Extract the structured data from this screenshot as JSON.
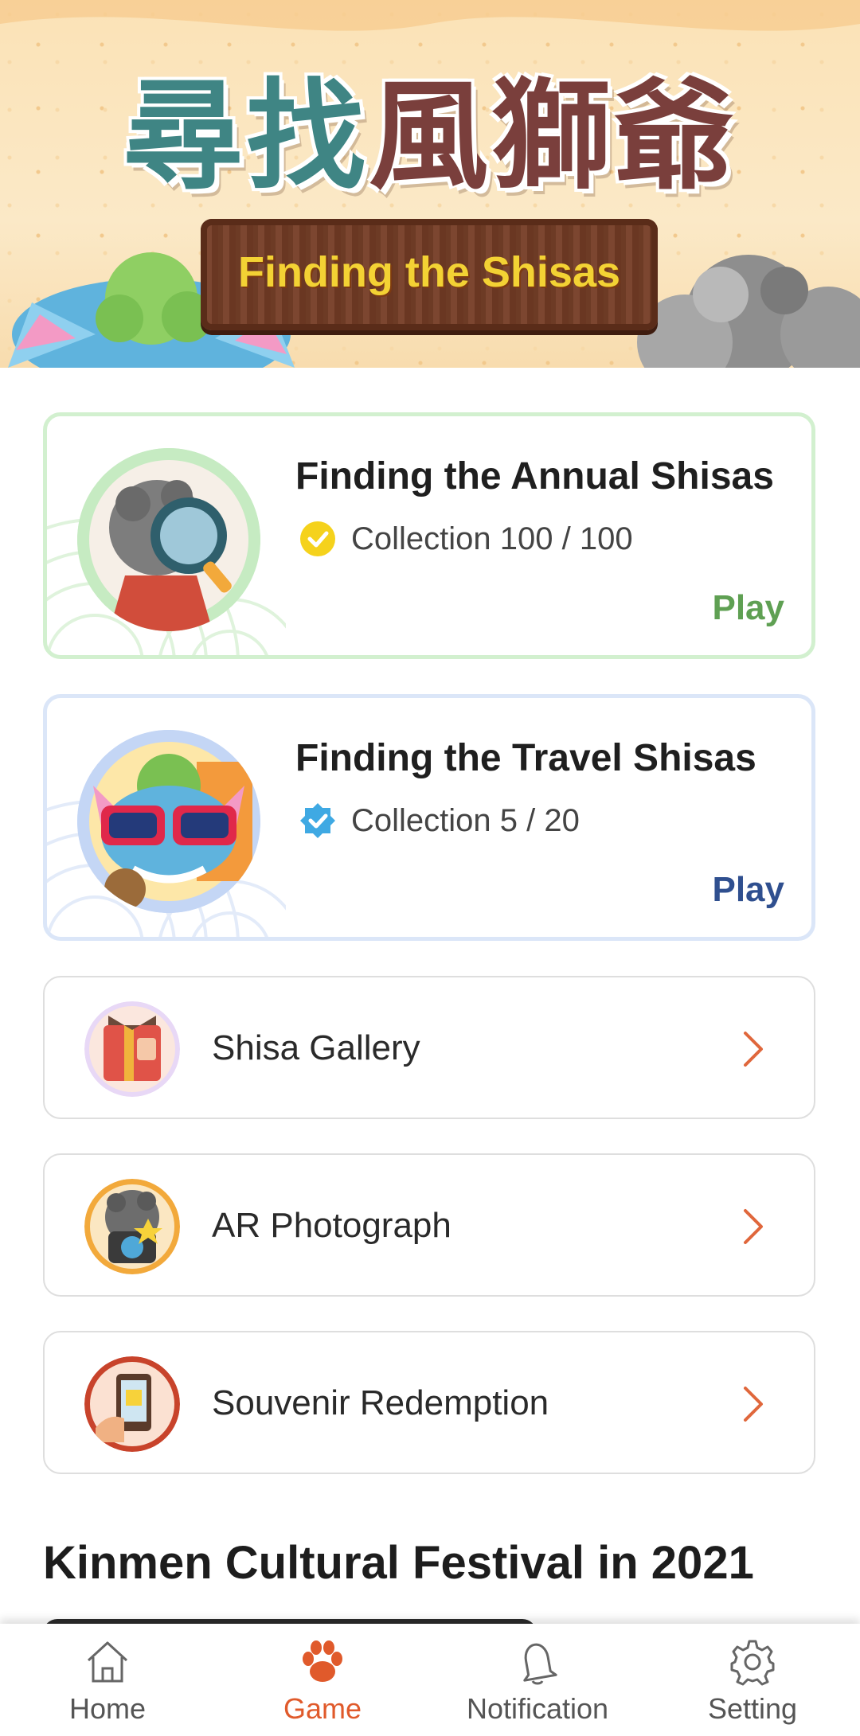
{
  "banner": {
    "title_zh_a": "尋找",
    "title_zh_b": "風獅爺",
    "title_en": "Finding the Shisas"
  },
  "games": [
    {
      "title": "Finding the Annual Shisas",
      "collection": "Collection 100 / 100",
      "play_label": "Play",
      "accent": "#5fa053"
    },
    {
      "title": "Finding the Travel Shisas",
      "collection": "Collection 5 / 20",
      "play_label": "Play",
      "accent": "#2f4f8f"
    }
  ],
  "menu": [
    {
      "label": "Shisa Gallery",
      "icon": "gallery-book-icon"
    },
    {
      "label": "AR Photograph",
      "icon": "ar-camera-icon"
    },
    {
      "label": "Souvenir Redemption",
      "icon": "souvenir-phone-icon"
    }
  ],
  "section": {
    "title": "Kinmen Cultural Festival in 2021"
  },
  "nav": {
    "items": [
      {
        "label": "Home",
        "icon": "home-icon"
      },
      {
        "label": "Game",
        "icon": "paw-icon",
        "active": true
      },
      {
        "label": "Notification",
        "icon": "bell-icon"
      },
      {
        "label": "Setting",
        "icon": "gear-icon"
      }
    ],
    "active_color": "#e05a2b"
  }
}
